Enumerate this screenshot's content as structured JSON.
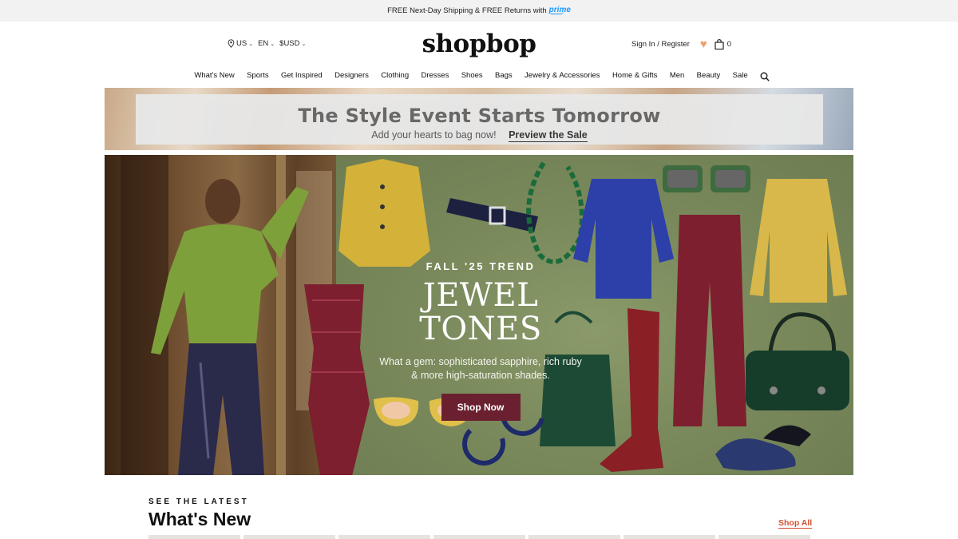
{
  "promo": {
    "text": "FREE Next-Day Shipping & FREE Returns with",
    "prime": "prime"
  },
  "header": {
    "locale": {
      "country": "US",
      "language": "EN",
      "currency": "$USD"
    },
    "logo": "shopbop",
    "account": {
      "signin": "Sign In / Register",
      "cart_count": "0"
    }
  },
  "nav": [
    "What's New",
    "Sports",
    "Get Inspired",
    "Designers",
    "Clothing",
    "Dresses",
    "Shoes",
    "Bags",
    "Jewelry & Accessories",
    "Home & Gifts",
    "Men",
    "Beauty",
    "Sale"
  ],
  "event": {
    "title": "The Style Event Starts Tomorrow",
    "subtitle": "Add your hearts to bag now!",
    "cta": "Preview the Sale"
  },
  "hero": {
    "kicker": "FALL '25 TREND",
    "title": "JEWEL TONES",
    "description": "What a gem: sophisticated sapphire, rich ruby & more high-saturation shades.",
    "button": "Shop Now",
    "colors": {
      "button": "#6b2030",
      "sapphire": "#2d3fa8",
      "ruby": "#7d1f2e",
      "emerald": "#1d4a35",
      "mustard": "#d4b23a",
      "olive": "#7ea03a"
    }
  },
  "section": {
    "kicker": "SEE THE LATEST",
    "title": "What's New",
    "shop_all": "Shop All"
  },
  "colors": {
    "accent": "#d2502f",
    "heart": "#f0a070",
    "prime": "#1a98ff"
  }
}
